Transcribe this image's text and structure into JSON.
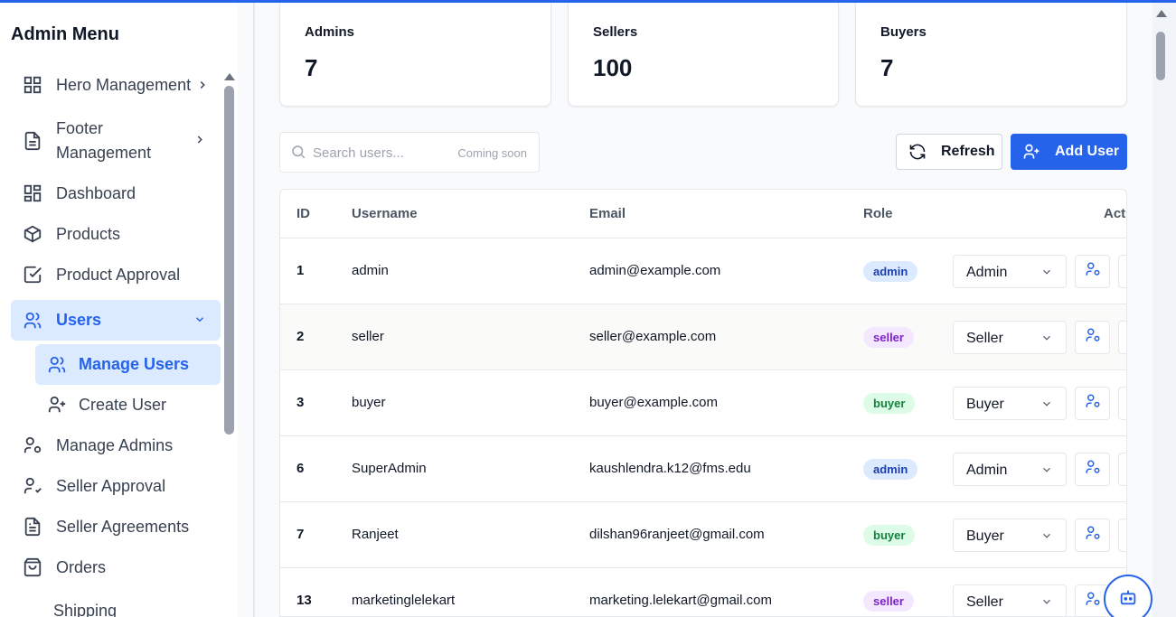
{
  "sidebar": {
    "title": "Admin Menu",
    "items": [
      {
        "label": "Hero Management"
      },
      {
        "label": "Footer"
      },
      {
        "label": "Management"
      },
      {
        "label": "Dashboard"
      },
      {
        "label": "Products"
      },
      {
        "label": "Product Approval"
      },
      {
        "label": "Users"
      },
      {
        "label": "Manage Users"
      },
      {
        "label": "Create User"
      },
      {
        "label": "Manage Admins"
      },
      {
        "label": "Seller Approval"
      },
      {
        "label": "Seller Agreements"
      },
      {
        "label": "Orders"
      },
      {
        "label": "Shipping"
      }
    ]
  },
  "stats": [
    {
      "label": "Admins",
      "value": "7"
    },
    {
      "label": "Sellers",
      "value": "100"
    },
    {
      "label": "Buyers",
      "value": "7"
    }
  ],
  "toolbar": {
    "search_placeholder": "Search users...",
    "search_hint": "Coming soon",
    "refresh_label": "Refresh",
    "add_label": "Add User"
  },
  "table": {
    "headers": [
      "ID",
      "Username",
      "Email",
      "Role",
      "Act"
    ],
    "rows": [
      {
        "id": "1",
        "username": "admin",
        "email": "admin@example.com",
        "badge": "admin",
        "select": "Admin"
      },
      {
        "id": "2",
        "username": "seller",
        "email": "seller@example.com",
        "badge": "seller",
        "select": "Seller"
      },
      {
        "id": "3",
        "username": "buyer",
        "email": "buyer@example.com",
        "badge": "buyer",
        "select": "Buyer"
      },
      {
        "id": "6",
        "username": "SuperAdmin",
        "email": "kaushlendra.k12@fms.edu",
        "badge": "admin",
        "select": "Admin"
      },
      {
        "id": "7",
        "username": "Ranjeet",
        "email": "dilshan96ranjeet@gmail.com",
        "badge": "buyer",
        "select": "Buyer"
      },
      {
        "id": "13",
        "username": "marketinglelekart",
        "email": "marketing.lelekart@gmail.com",
        "badge": "seller",
        "select": "Seller"
      }
    ]
  },
  "colors": {
    "accent": "#2563eb",
    "active_bg": "#dbeafe",
    "badge_admin": "#dbeafe",
    "badge_seller": "#f3e8ff",
    "badge_buyer": "#dcfce7"
  },
  "icons": {
    "hero": "grid-icon",
    "footer": "document-icon",
    "dashboard": "dashboard-icon",
    "products": "box-icon",
    "product_approval": "check-square-icon",
    "users": "users-icon",
    "create_user": "user-plus-icon",
    "manage_admins": "user-cog-icon",
    "seller_approval": "user-check-icon",
    "seller_agreements": "file-text-icon",
    "orders": "shopping-bag-icon",
    "search": "search-icon",
    "refresh": "refresh-icon",
    "add_user": "user-plus-icon",
    "chat": "bot-icon"
  }
}
